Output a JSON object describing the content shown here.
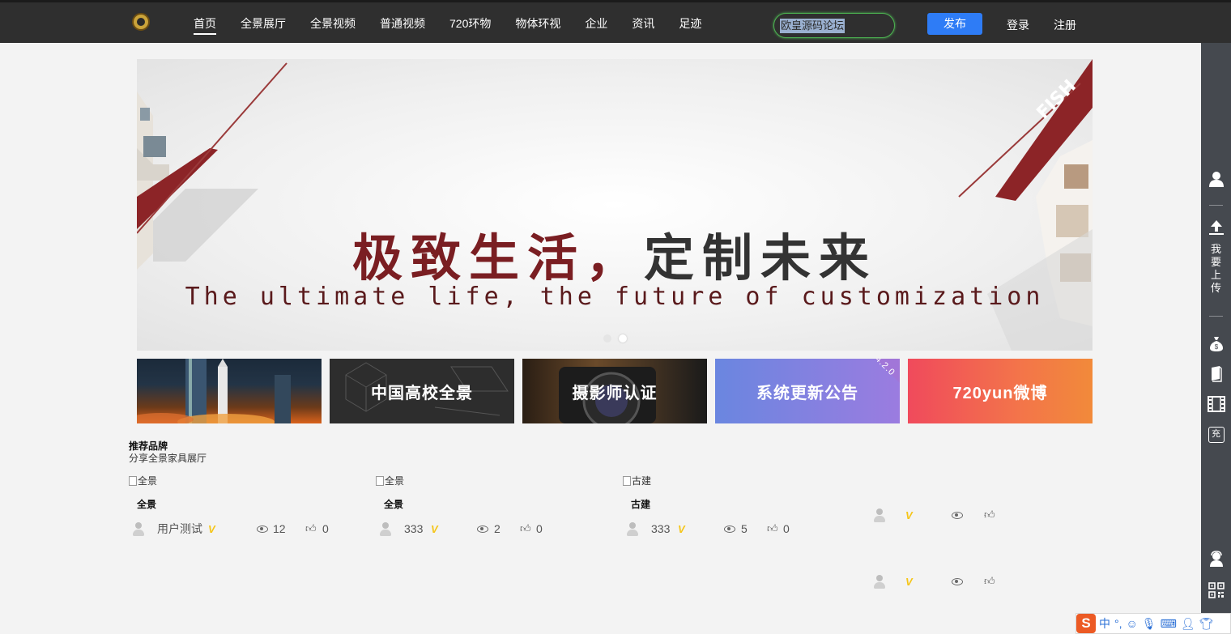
{
  "nav": {
    "items": [
      "首页",
      "全景展厅",
      "全景视频",
      "普通视频",
      "720环物",
      "物体环视",
      "企业",
      "资讯",
      "足迹"
    ],
    "search_value": "欧皇源码论坛",
    "publish": "发布",
    "login": "登录",
    "register": "注册"
  },
  "sidebar": {
    "upload_text": "我要上传",
    "charge": "充"
  },
  "banner": {
    "title_red": "极致生活，",
    "title_dark": "定制未来",
    "subtitle": "The ultimate life, the future of customization",
    "corner_text": "FISH"
  },
  "tiles": [
    {
      "label": ""
    },
    {
      "label": "中国高校全景"
    },
    {
      "label": "摄影师认证"
    },
    {
      "label": "系统更新公告",
      "corner": "4.2.0"
    },
    {
      "label": "720yun微博"
    }
  ],
  "section": {
    "title": "推荐品牌",
    "subtitle": "分享全景家具展厅"
  },
  "cards": [
    {
      "img_alt": "全景",
      "name": "全景",
      "user": "用户测试",
      "views": "12",
      "likes": "0"
    },
    {
      "img_alt": "全景",
      "name": "全景",
      "user": "333",
      "views": "2",
      "likes": "0"
    },
    {
      "img_alt": "古建",
      "name": "古建",
      "user": "333",
      "views": "5",
      "likes": "0"
    }
  ],
  "ime": {
    "logo": "S",
    "lang": "中",
    "punct": "°,"
  }
}
